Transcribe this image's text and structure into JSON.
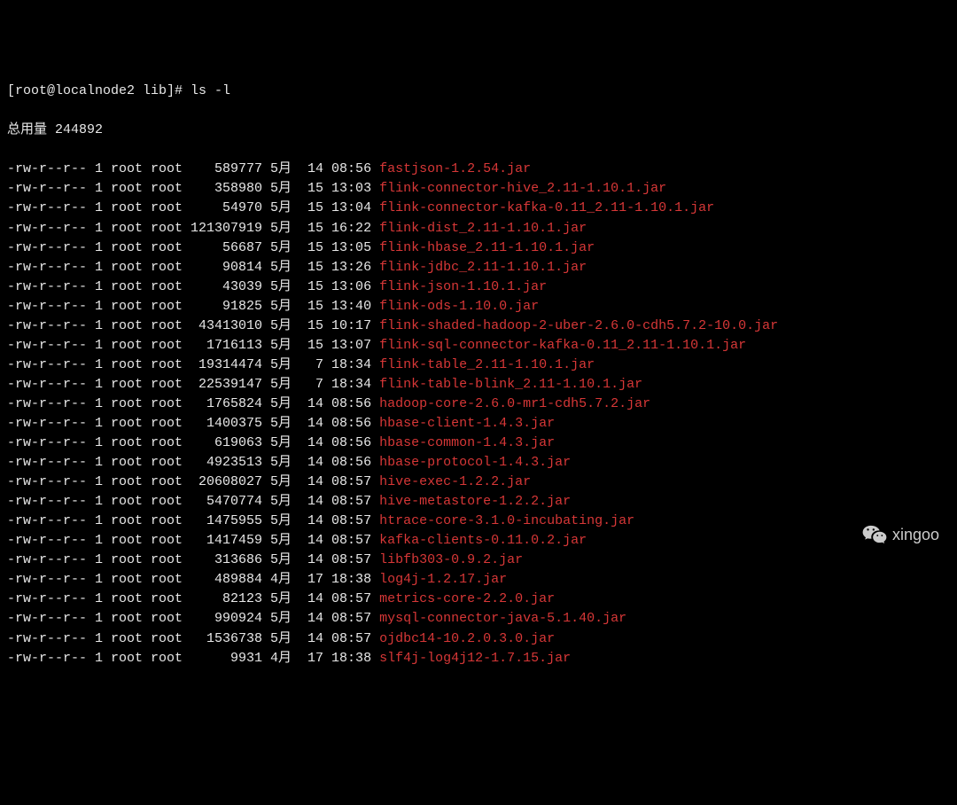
{
  "prompt": "[root@localnode2 lib]# ls -l",
  "total_line": "总用量 244892",
  "watermark": "xingoo",
  "rows": [
    {
      "perm": "-rw-r--r--",
      "links": "1",
      "owner": "root",
      "group": "root",
      "size": "589777",
      "month": "5月",
      "day": "14",
      "time": "08:56",
      "name": "fastjson-1.2.54.jar"
    },
    {
      "perm": "-rw-r--r--",
      "links": "1",
      "owner": "root",
      "group": "root",
      "size": "358980",
      "month": "5月",
      "day": "15",
      "time": "13:03",
      "name": "flink-connector-hive_2.11-1.10.1.jar"
    },
    {
      "perm": "-rw-r--r--",
      "links": "1",
      "owner": "root",
      "group": "root",
      "size": "54970",
      "month": "5月",
      "day": "15",
      "time": "13:04",
      "name": "flink-connector-kafka-0.11_2.11-1.10.1.jar"
    },
    {
      "perm": "-rw-r--r--",
      "links": "1",
      "owner": "root",
      "group": "root",
      "size": "121307919",
      "month": "5月",
      "day": "15",
      "time": "16:22",
      "name": "flink-dist_2.11-1.10.1.jar"
    },
    {
      "perm": "-rw-r--r--",
      "links": "1",
      "owner": "root",
      "group": "root",
      "size": "56687",
      "month": "5月",
      "day": "15",
      "time": "13:05",
      "name": "flink-hbase_2.11-1.10.1.jar"
    },
    {
      "perm": "-rw-r--r--",
      "links": "1",
      "owner": "root",
      "group": "root",
      "size": "90814",
      "month": "5月",
      "day": "15",
      "time": "13:26",
      "name": "flink-jdbc_2.11-1.10.1.jar"
    },
    {
      "perm": "-rw-r--r--",
      "links": "1",
      "owner": "root",
      "group": "root",
      "size": "43039",
      "month": "5月",
      "day": "15",
      "time": "13:06",
      "name": "flink-json-1.10.1.jar"
    },
    {
      "perm": "-rw-r--r--",
      "links": "1",
      "owner": "root",
      "group": "root",
      "size": "91825",
      "month": "5月",
      "day": "15",
      "time": "13:40",
      "name": "flink-ods-1.10.0.jar"
    },
    {
      "perm": "-rw-r--r--",
      "links": "1",
      "owner": "root",
      "group": "root",
      "size": "43413010",
      "month": "5月",
      "day": "15",
      "time": "10:17",
      "name": "flink-shaded-hadoop-2-uber-2.6.0-cdh5.7.2-10.0.jar"
    },
    {
      "perm": "-rw-r--r--",
      "links": "1",
      "owner": "root",
      "group": "root",
      "size": "1716113",
      "month": "5月",
      "day": "15",
      "time": "13:07",
      "name": "flink-sql-connector-kafka-0.11_2.11-1.10.1.jar"
    },
    {
      "perm": "-rw-r--r--",
      "links": "1",
      "owner": "root",
      "group": "root",
      "size": "19314474",
      "month": "5月",
      "day": "7",
      "time": "18:34",
      "name": "flink-table_2.11-1.10.1.jar"
    },
    {
      "perm": "-rw-r--r--",
      "links": "1",
      "owner": "root",
      "group": "root",
      "size": "22539147",
      "month": "5月",
      "day": "7",
      "time": "18:34",
      "name": "flink-table-blink_2.11-1.10.1.jar"
    },
    {
      "perm": "-rw-r--r--",
      "links": "1",
      "owner": "root",
      "group": "root",
      "size": "1765824",
      "month": "5月",
      "day": "14",
      "time": "08:56",
      "name": "hadoop-core-2.6.0-mr1-cdh5.7.2.jar"
    },
    {
      "perm": "-rw-r--r--",
      "links": "1",
      "owner": "root",
      "group": "root",
      "size": "1400375",
      "month": "5月",
      "day": "14",
      "time": "08:56",
      "name": "hbase-client-1.4.3.jar"
    },
    {
      "perm": "-rw-r--r--",
      "links": "1",
      "owner": "root",
      "group": "root",
      "size": "619063",
      "month": "5月",
      "day": "14",
      "time": "08:56",
      "name": "hbase-common-1.4.3.jar"
    },
    {
      "perm": "-rw-r--r--",
      "links": "1",
      "owner": "root",
      "group": "root",
      "size": "4923513",
      "month": "5月",
      "day": "14",
      "time": "08:56",
      "name": "hbase-protocol-1.4.3.jar"
    },
    {
      "perm": "-rw-r--r--",
      "links": "1",
      "owner": "root",
      "group": "root",
      "size": "20608027",
      "month": "5月",
      "day": "14",
      "time": "08:57",
      "name": "hive-exec-1.2.2.jar"
    },
    {
      "perm": "-rw-r--r--",
      "links": "1",
      "owner": "root",
      "group": "root",
      "size": "5470774",
      "month": "5月",
      "day": "14",
      "time": "08:57",
      "name": "hive-metastore-1.2.2.jar"
    },
    {
      "perm": "-rw-r--r--",
      "links": "1",
      "owner": "root",
      "group": "root",
      "size": "1475955",
      "month": "5月",
      "day": "14",
      "time": "08:57",
      "name": "htrace-core-3.1.0-incubating.jar"
    },
    {
      "perm": "-rw-r--r--",
      "links": "1",
      "owner": "root",
      "group": "root",
      "size": "1417459",
      "month": "5月",
      "day": "14",
      "time": "08:57",
      "name": "kafka-clients-0.11.0.2.jar"
    },
    {
      "perm": "-rw-r--r--",
      "links": "1",
      "owner": "root",
      "group": "root",
      "size": "313686",
      "month": "5月",
      "day": "14",
      "time": "08:57",
      "name": "libfb303-0.9.2.jar"
    },
    {
      "perm": "-rw-r--r--",
      "links": "1",
      "owner": "root",
      "group": "root",
      "size": "489884",
      "month": "4月",
      "day": "17",
      "time": "18:38",
      "name": "log4j-1.2.17.jar"
    },
    {
      "perm": "-rw-r--r--",
      "links": "1",
      "owner": "root",
      "group": "root",
      "size": "82123",
      "month": "5月",
      "day": "14",
      "time": "08:57",
      "name": "metrics-core-2.2.0.jar"
    },
    {
      "perm": "-rw-r--r--",
      "links": "1",
      "owner": "root",
      "group": "root",
      "size": "990924",
      "month": "5月",
      "day": "14",
      "time": "08:57",
      "name": "mysql-connector-java-5.1.40.jar"
    },
    {
      "perm": "-rw-r--r--",
      "links": "1",
      "owner": "root",
      "group": "root",
      "size": "1536738",
      "month": "5月",
      "day": "14",
      "time": "08:57",
      "name": "ojdbc14-10.2.0.3.0.jar"
    },
    {
      "perm": "-rw-r--r--",
      "links": "1",
      "owner": "root",
      "group": "root",
      "size": "9931",
      "month": "4月",
      "day": "17",
      "time": "18:38",
      "name": "slf4j-log4j12-1.7.15.jar"
    }
  ]
}
